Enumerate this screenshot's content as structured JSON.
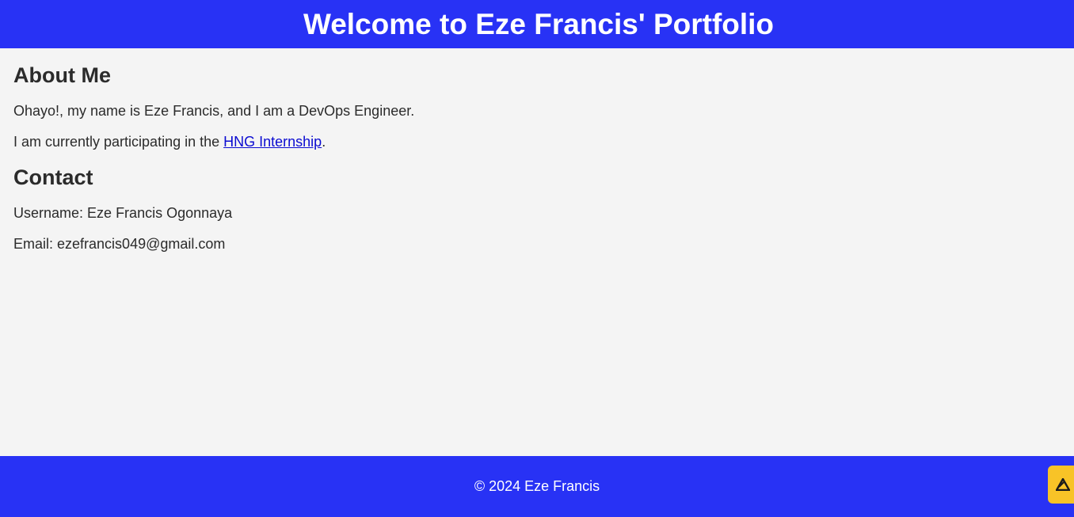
{
  "header": {
    "title": "Welcome to Eze Francis' Portfolio"
  },
  "about": {
    "heading": "About Me",
    "intro": "Ohayo!, my name is Eze Francis, and I am a DevOps Engineer.",
    "participation_prefix": "I am currently participating in the ",
    "internship_link_label": "HNG Internship",
    "participation_suffix": "."
  },
  "contact": {
    "heading": "Contact",
    "username_label": "Username: ",
    "username_value": "Eze Francis Ogonnaya",
    "email_label": "Email: ",
    "email_value": "ezefrancis049@gmail.com"
  },
  "footer": {
    "copyright": "© 2024 Eze Francis"
  },
  "floating_button": {
    "icon": "triangle-logo-icon",
    "color": "#f8c327"
  },
  "colors": {
    "brand": "#2832f5",
    "background": "#f4f4f4",
    "link": "#0b0bd1"
  }
}
